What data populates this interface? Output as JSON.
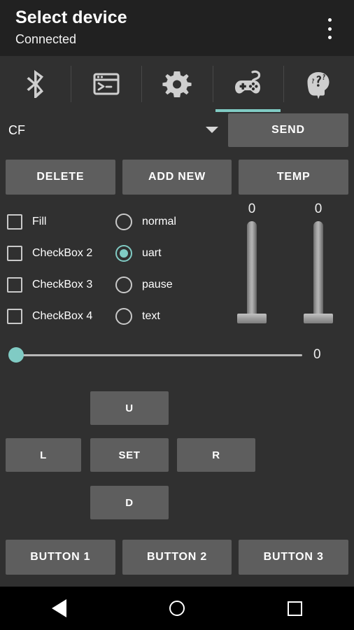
{
  "colors": {
    "accent": "#80cbc4",
    "titlebar_bg": "#212121",
    "window_bg": "#303030",
    "button_bg": "#5e5e5e",
    "text": "#ffffff",
    "navbar_bg": "#000000"
  },
  "titlebar": {
    "title": "Select device",
    "subtitle": "Connected",
    "overflow_icon": "overflow-menu-icon"
  },
  "tabs": [
    {
      "name": "bluetooth",
      "icon": "bluetooth-icon",
      "active": false
    },
    {
      "name": "terminal",
      "icon": "terminal-icon",
      "active": false
    },
    {
      "name": "settings",
      "icon": "gear-icon",
      "active": false
    },
    {
      "name": "gamepad",
      "icon": "gamepad-icon",
      "active": true
    },
    {
      "name": "help",
      "icon": "head-question-icon",
      "active": false
    }
  ],
  "command_row": {
    "spinner_value": "CF",
    "spinner_caret_icon": "chevron-down-icon",
    "send_label": "SEND"
  },
  "action_buttons": [
    {
      "label": "DELETE"
    },
    {
      "label": "ADD NEW"
    },
    {
      "label": "TEMP"
    }
  ],
  "checkboxes": [
    {
      "label": "Fill",
      "checked": false
    },
    {
      "label": "CheckBox 2",
      "checked": false
    },
    {
      "label": "CheckBox 3",
      "checked": false
    },
    {
      "label": "CheckBox 4",
      "checked": false
    }
  ],
  "radios": [
    {
      "label": "normal",
      "selected": false
    },
    {
      "label": "uart",
      "selected": true
    },
    {
      "label": "pause",
      "selected": false
    },
    {
      "label": "text",
      "selected": false
    }
  ],
  "levers": [
    {
      "name": "lever-1",
      "value": "0"
    },
    {
      "name": "lever-2",
      "value": "0"
    }
  ],
  "seekbar": {
    "value": "0",
    "position_percent": 0
  },
  "dpad": {
    "up_label": "U",
    "left_label": "L",
    "set_label": "SET",
    "right_label": "R",
    "down_label": "D"
  },
  "bottom_buttons": [
    {
      "label": "BUTTON 1"
    },
    {
      "label": "BUTTON 2"
    },
    {
      "label": "BUTTON 3"
    }
  ],
  "navbar": {
    "back_icon": "back-triangle-icon",
    "home_icon": "home-circle-icon",
    "recents_icon": "recents-square-icon"
  }
}
